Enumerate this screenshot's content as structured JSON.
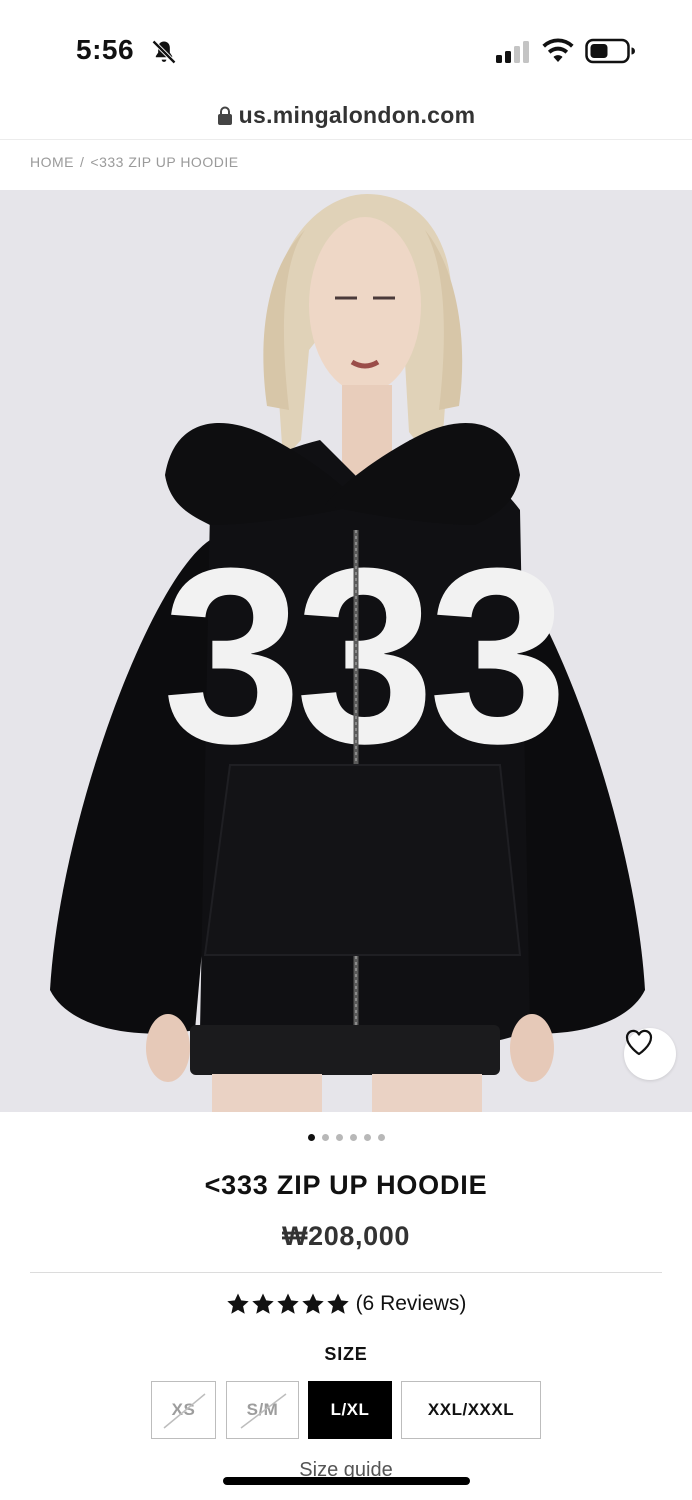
{
  "status_bar": {
    "time": "5:56"
  },
  "browser": {
    "url": "us.mingalondon.com"
  },
  "breadcrumb": {
    "home": "HOME",
    "separator": "/",
    "current": "<333 ZIP UP HOODIE"
  },
  "hero": {
    "print_text": "333",
    "image_count": 6,
    "active_index": 0
  },
  "product": {
    "title": "<333 ZIP UP HOODIE",
    "price": "₩208,000",
    "rating": 5,
    "reviews_text": "(6 Reviews)"
  },
  "size": {
    "label": "SIZE",
    "options": [
      {
        "label": "XS",
        "available": false,
        "selected": false
      },
      {
        "label": "S/M",
        "available": false,
        "selected": false
      },
      {
        "label": "L/XL",
        "available": true,
        "selected": true
      },
      {
        "label": "XXL/XXXL",
        "available": true,
        "selected": false
      }
    ],
    "guide_link": "Size guide"
  },
  "colors": {
    "text": "#111111",
    "muted": "#9a9a9a",
    "hero_bg": "#e6e5ea",
    "selected_bg": "#000000"
  },
  "icons": [
    "bell-slash-icon",
    "cellular-signal-icon",
    "wifi-icon",
    "battery-icon",
    "lock-icon",
    "heart-icon",
    "star-icon"
  ]
}
